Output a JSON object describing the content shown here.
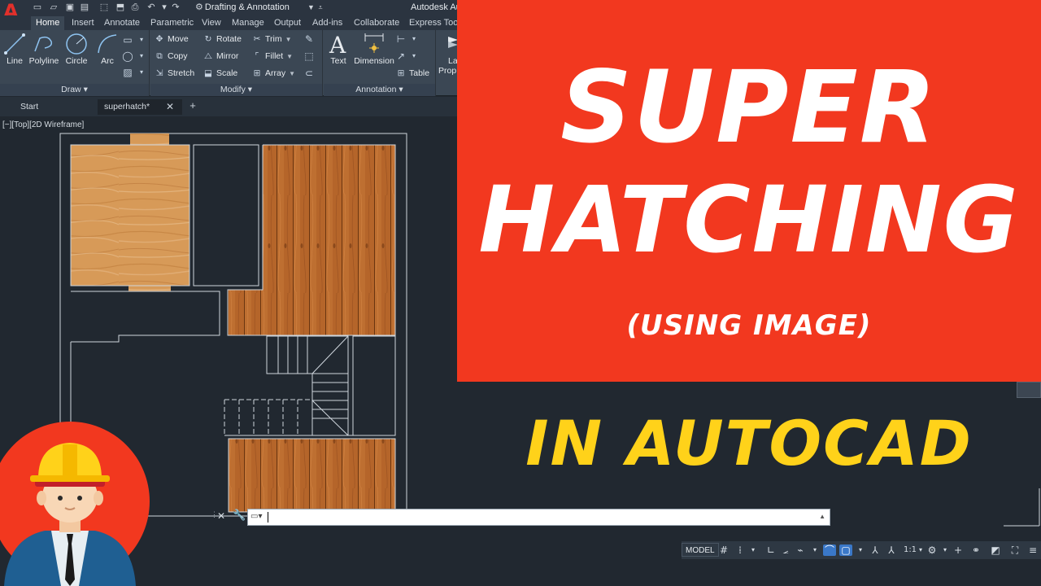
{
  "quick_access": {
    "workspace_name": "Drafting & Annotation",
    "app_title": "Autodesk AutoCAD",
    "icons": [
      "new-icon",
      "open-icon",
      "save-icon",
      "save-as-icon",
      "open-web-icon",
      "save-web-icon",
      "plot-icon",
      "undo-icon",
      "redo-icon",
      "gear-icon"
    ]
  },
  "ribbon_tabs": [
    "Home",
    "Insert",
    "Annotate",
    "Parametric",
    "View",
    "Manage",
    "Output",
    "Add-ins",
    "Collaborate",
    "Express Tools"
  ],
  "active_tab": "Home",
  "ribbon": {
    "draw": {
      "title": "Draw",
      "tools": [
        "Line",
        "Polyline",
        "Circle",
        "Arc"
      ]
    },
    "modify": {
      "title": "Modify",
      "tools": [
        "Move",
        "Rotate",
        "Trim",
        "Copy",
        "Mirror",
        "Fillet",
        "Stretch",
        "Scale",
        "Array"
      ]
    },
    "annotation": {
      "title": "Annotation",
      "tools": [
        "Text",
        "Dimension",
        "Table"
      ]
    },
    "layers": {
      "label_line1": "La",
      "label_line2": "Prop"
    }
  },
  "file_tabs": [
    {
      "label": "Start",
      "active": false
    },
    {
      "label": "superhatch*",
      "active": true
    }
  ],
  "viewport_label": "[−][Top][2D Wireframe]",
  "command_line": {
    "value": "",
    "prompt_icon": "command-prompt-icon"
  },
  "status_bar": {
    "model_label": "MODEL",
    "annotation_scale": "1:1",
    "tools": [
      "grid-icon",
      "snap-icon",
      "ortho-icon",
      "polar-icon",
      "isodraft-icon",
      "osnap-icon",
      "selection-icon",
      "annotation-visibility-icon",
      "autoscale-icon",
      "annotation-scale-icon",
      "workspace-gear-icon",
      "plus-icon",
      "isolate-icon",
      "hardware-accel-icon",
      "fullscreen-icon",
      "customize-menu-icon"
    ]
  },
  "thumbnail": {
    "title_line1": "SUPER",
    "title_line2": "HATCHING",
    "subtitle": "(USING IMAGE)",
    "tagline": "IN AUTOCAD",
    "colors": {
      "banner": "#f2381f",
      "tagline": "#ffd21a",
      "avatar_circle": "#f2381f",
      "helmet": "#ffd21a"
    }
  },
  "colors": {
    "canvas": "#212830",
    "ribbon": "#3b4754",
    "titlebar": "#2b3440",
    "wood_light": "#d79a58",
    "wood_planks": "#b5652a"
  }
}
